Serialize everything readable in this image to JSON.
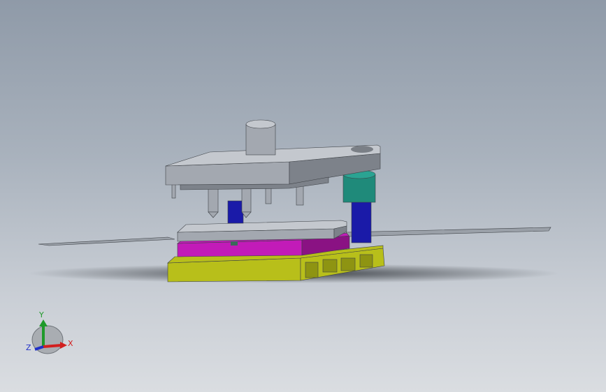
{
  "viewport": {
    "background_top": "#8f9aa8",
    "background_bottom": "#dadde1"
  },
  "model": {
    "colors": {
      "plate_gray": "#a3a8b0",
      "plate_gray_dark": "#7d828a",
      "plate_gray_light": "#c4c8ce",
      "guide_post_blue": "#1a1aa8",
      "guide_bush_teal": "#1f8a7a",
      "die_plate_magenta": "#c21bb8",
      "die_plate_magenta_dark": "#8a1283",
      "base_plate_olive": "#b8bf1a",
      "base_plate_olive_dark": "#8e9412",
      "strip_gray": "#9aa0a8"
    }
  },
  "triad": {
    "x_label": "X",
    "y_label": "Y",
    "z_label": "Z",
    "x_color": "#d21f1f",
    "y_color": "#1f9a2a",
    "z_color": "#2030c8"
  }
}
